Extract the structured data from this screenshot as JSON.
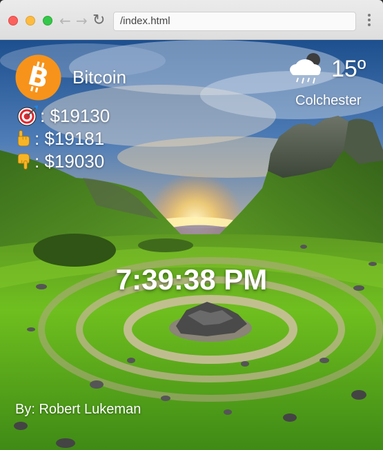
{
  "browser": {
    "url": "/index.html"
  },
  "crypto": {
    "name": "Bitcoin",
    "logo_icon": "bitcoin-icon",
    "accent_color": "#f7931a",
    "current": ": $19130",
    "high": ": $19181",
    "low": ": $19030"
  },
  "weather": {
    "icon": "cloud-rain-icon",
    "temperature": "15º",
    "city": "Colchester"
  },
  "clock": {
    "time": "7:39:38 PM"
  },
  "footer": {
    "author": "By: Robert Lukeman"
  }
}
